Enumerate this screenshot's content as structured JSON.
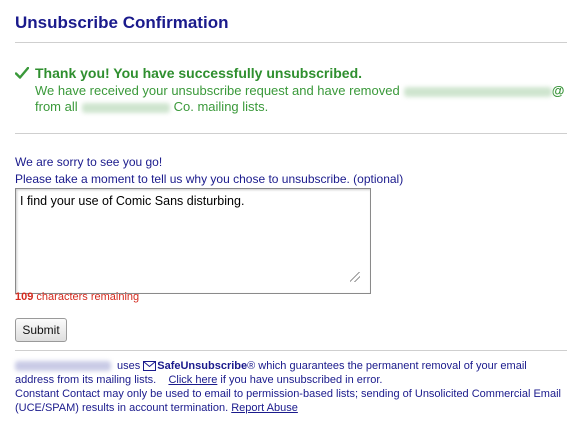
{
  "page": {
    "title": "Unsubscribe Confirmation"
  },
  "success": {
    "headline": "Thank you! You have successfully unsubscribed.",
    "line1": "We have received your unsubscribe request and have removed",
    "email_at": "@",
    "line2_prefix": "from all",
    "line2_suffix": "Co. mailing lists."
  },
  "feedback": {
    "sorry": "We are sorry to see you go!",
    "prompt": "Please take a moment to tell us why you chose to unsubscribe. (optional)",
    "reason_value": "I find your use of Comic Sans disturbing.",
    "remaining_count": "109",
    "remaining_label": "characters remaining"
  },
  "form": {
    "submit_label": "Submit"
  },
  "footer": {
    "uses": "uses",
    "safeunsubscribe": "SafeUnsubscribe",
    "registered": "®",
    "guarantees": "which guarantees the permanent removal of your email",
    "line2a": "address from its mailing lists.",
    "click_here": "Click here",
    "line2b": "if you have unsubscribed in error.",
    "line3": "Constant Contact may only be used to email to permission-based lists; sending of Unsolicited Commercial Email",
    "line4a": "(UCE/SPAM) results in account termination.",
    "report_abuse": "Report Abuse"
  },
  "colors": {
    "title": "#1a1a8c",
    "success": "#2f8f2f",
    "warning": "#d42a1e"
  },
  "icons": {
    "success": "checkmark-icon",
    "safeunsubscribe": "envelope-icon",
    "resize": "resize-grip-icon"
  }
}
